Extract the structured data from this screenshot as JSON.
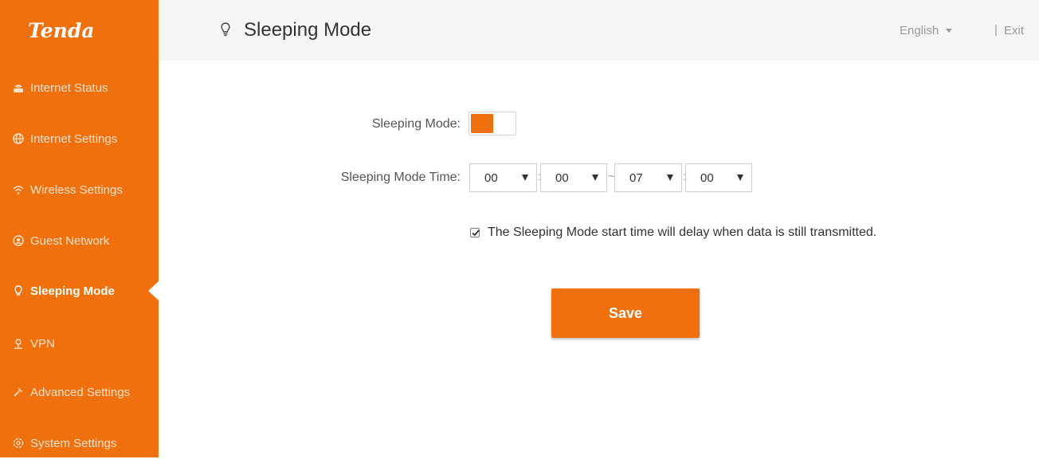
{
  "brand": {
    "logo_text": "Tenda",
    "accent_color": "#f0700d"
  },
  "sidebar": {
    "items": [
      {
        "label": "Internet Status",
        "icon": "router-icon",
        "active": false
      },
      {
        "label": "Internet Settings",
        "icon": "globe-icon",
        "active": false
      },
      {
        "label": "Wireless Settings",
        "icon": "wifi-icon",
        "active": false
      },
      {
        "label": "Guest Network",
        "icon": "guest-network-icon",
        "active": false
      },
      {
        "label": "Sleeping Mode",
        "icon": "lightbulb-icon",
        "active": true
      },
      {
        "label": "VPN",
        "icon": "vpn-icon",
        "active": false
      },
      {
        "label": "Advanced Settings",
        "icon": "wrench-icon",
        "active": false
      },
      {
        "label": "System Settings",
        "icon": "gear-icon",
        "active": false
      }
    ]
  },
  "header": {
    "title": "Sleeping Mode",
    "title_icon": "lightbulb-icon",
    "language": "English",
    "separator": "|",
    "exit_label": "Exit"
  },
  "form": {
    "mode_label": "Sleeping Mode:",
    "mode_enabled": true,
    "time_label": "Sleeping Mode Time:",
    "start_hour": "00",
    "start_minute": "00",
    "end_hour": "07",
    "end_minute": "00",
    "colon": ":",
    "tilde": "~",
    "delay_checked": true,
    "delay_text": "The Sleeping Mode start time will delay when data is still transmitted.",
    "save_label": "Save"
  }
}
